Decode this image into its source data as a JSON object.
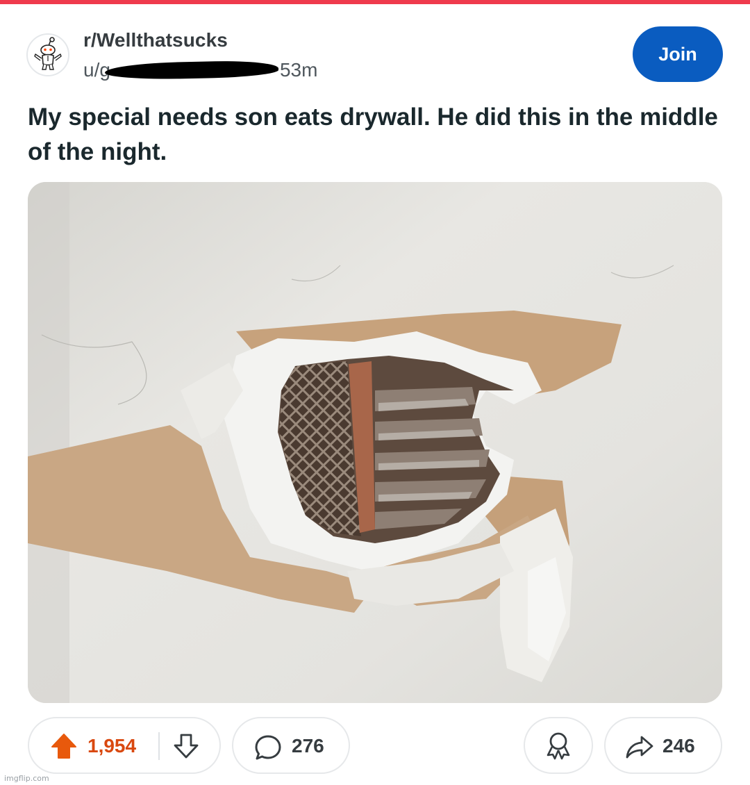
{
  "subreddit": {
    "name": "r/Wellthatsucks"
  },
  "post": {
    "user_prefix": "u/g",
    "time": "53m",
    "title": "My special needs son eats drywall. He did this in the middle of the night."
  },
  "join_button": {
    "label": "Join",
    "color": "#0a5cc0"
  },
  "actions": {
    "upvotes": "1,954",
    "comments": "276",
    "shares": "246",
    "upvote_color": "#e8590c"
  },
  "watermark": "imgflip.com",
  "colors": {
    "top_bar": "#ef3a4d",
    "text": "#1a282d"
  }
}
